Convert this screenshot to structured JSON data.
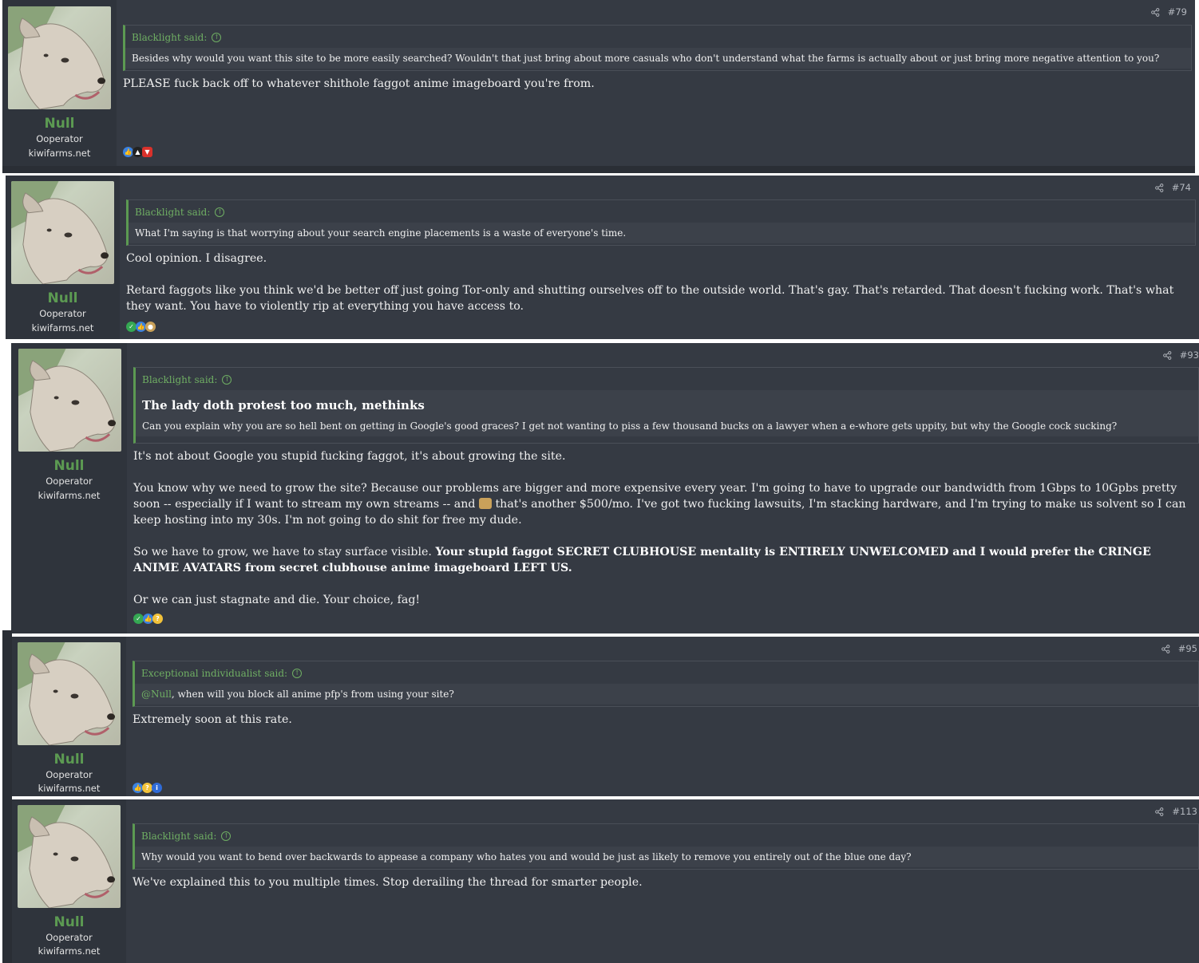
{
  "posts": [
    {
      "number": "#79",
      "user": {
        "name": "Null",
        "title": "Ooperator",
        "site": "kiwifarms.net"
      },
      "quote": {
        "author": "Blacklight said:",
        "text": "Besides why would you want this site to be more easily searched? Wouldn't that just bring about more casuals who don't understand what the farms is actually about or just bring more negative attention to you?"
      },
      "body": [
        "PLEASE fuck back off to whatever shithole faggot anime imageboard you're from."
      ],
      "reactions": [
        "like-icon",
        "hat-icon",
        "red-flag-icon"
      ]
    },
    {
      "number": "#74",
      "user": {
        "name": "Null",
        "title": "Ooperator",
        "site": "kiwifarms.net"
      },
      "quote": {
        "author": "Blacklight said:",
        "text": "What I'm saying is that worrying about your search engine placements is a waste of everyone's time."
      },
      "body": [
        "Cool opinion. I disagree.",
        "Retard faggots like you think we'd be better off just going Tor-only and shutting ourselves off to the outside world. That's gay. That's retarded. That doesn't fucking work. That's what they want. You have to violently rip at everything you have access to."
      ],
      "reactions": [
        "check-icon",
        "like-icon",
        "wolf-icon"
      ]
    },
    {
      "number": "#93",
      "user": {
        "name": "Null",
        "title": "Ooperator",
        "site": "kiwifarms.net"
      },
      "quote": {
        "author": "Blacklight said:",
        "title": "The lady doth protest too much, methinks",
        "text": "Can you explain why you are so hell bent on getting in Google's good graces? I get not wanting to piss a few thousand bucks on a lawyer when a e-whore gets uppity, but why the Google cock sucking?"
      },
      "body": {
        "p1": "It's not about Google you stupid fucking faggot, it's about growing the site.",
        "p2a": "You know why we need to grow the site? Because our problems are bigger and more expensive every year. I'm going to have to upgrade our bandwidth from 1Gbps to 10Gpbs pretty soon -- especially if I want to stream my own streams -- and",
        "p2b": "that's another $500/mo. I've got two fucking lawsuits, I'm stacking hardware, and I'm trying to make us solvent so I can keep hosting into my 30s. I'm not going to do shit for free my dude.",
        "p3a": "So we have to grow, we have to stay surface visible.",
        "p3b": "Your stupid faggot SECRET CLUBHOUSE mentality is ENTIRELY UNWELCOMED and I would prefer the CRINGE ANIME AVATARS from secret clubhouse anime imageboard LEFT US.",
        "p4": "Or we can just stagnate and die. Your choice, fag!"
      },
      "reactions": [
        "check-icon",
        "like-icon",
        "thinking-icon"
      ]
    },
    {
      "number": "#95",
      "user": {
        "name": "Null",
        "title": "Ooperator",
        "site": "kiwifarms.net"
      },
      "quote": {
        "author": "Exceptional individualist said:",
        "mention": "@Null",
        "text": ", when will you block all anime pfp's from using your site?"
      },
      "body": [
        "Extremely soon at this rate."
      ],
      "reactions": [
        "like-icon",
        "thinking-icon",
        "info-icon"
      ]
    },
    {
      "number": "#113",
      "user": {
        "name": "Null",
        "title": "Ooperator",
        "site": "kiwifarms.net"
      },
      "quote": {
        "author": "Blacklight said:",
        "text": "Why would you want to bend over backwards to appease a company who hates you and would be just as likely to remove you entirely out of the blue one day?"
      },
      "body": [
        "We've explained this to you multiple times. Stop derailing the thread for smarter people."
      ],
      "reactions": []
    }
  ],
  "colors": {
    "background": "#353a43",
    "sidebar": "#2f343c",
    "username": "#5c9a52",
    "quote_accent": "#5c9a52"
  }
}
